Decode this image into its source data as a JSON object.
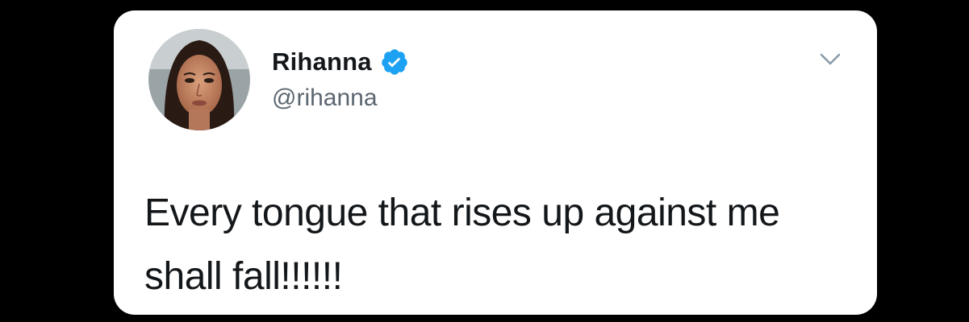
{
  "tweet": {
    "display_name": "Rihanna",
    "handle": "@rihanna",
    "verified": true,
    "text": "Every tongue that rises up against me\nshall fall!!!!!!"
  },
  "icons": {
    "verified": "verified-badge-icon",
    "menu": "chevron-down-icon",
    "avatar": "profile-photo"
  },
  "colors": {
    "background": "#000000",
    "card": "#ffffff",
    "verified_blue": "#1da1f2",
    "name_text": "#14171a",
    "handle_text": "#5b6670",
    "chevron": "#8899a6"
  }
}
